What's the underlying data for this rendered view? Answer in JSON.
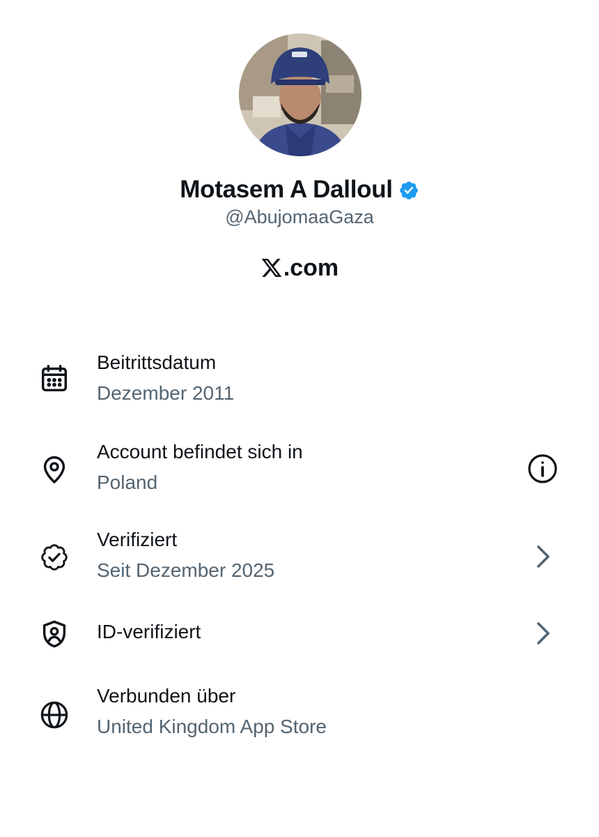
{
  "profile": {
    "display_name": "Motasem A Dalloul",
    "handle": "@AbujomaaGaza",
    "site": ".com",
    "verified_badge_icon": "verified-badge-icon",
    "badge_color": "#1d9bf0"
  },
  "about": {
    "items": [
      {
        "icon": "calendar-icon",
        "title": "Beitrittsdatum",
        "subtitle": "Dezember 2011"
      },
      {
        "icon": "location-pin-icon",
        "title": "Account befindet sich in",
        "subtitle": "Poland",
        "action_icon": "info-icon"
      },
      {
        "icon": "verified-check-icon",
        "title": "Verifiziert",
        "subtitle": "Seit Dezember 2025",
        "action_icon": "chevron-right-icon"
      },
      {
        "icon": "id-shield-icon",
        "title": "ID-verifiziert",
        "action_icon": "chevron-right-icon"
      },
      {
        "icon": "globe-icon",
        "title": "Verbunden über",
        "subtitle": "United Kingdom App Store"
      }
    ]
  },
  "colors": {
    "primary_text": "#0f1419",
    "secondary_text": "#536471",
    "background": "#ffffff"
  }
}
